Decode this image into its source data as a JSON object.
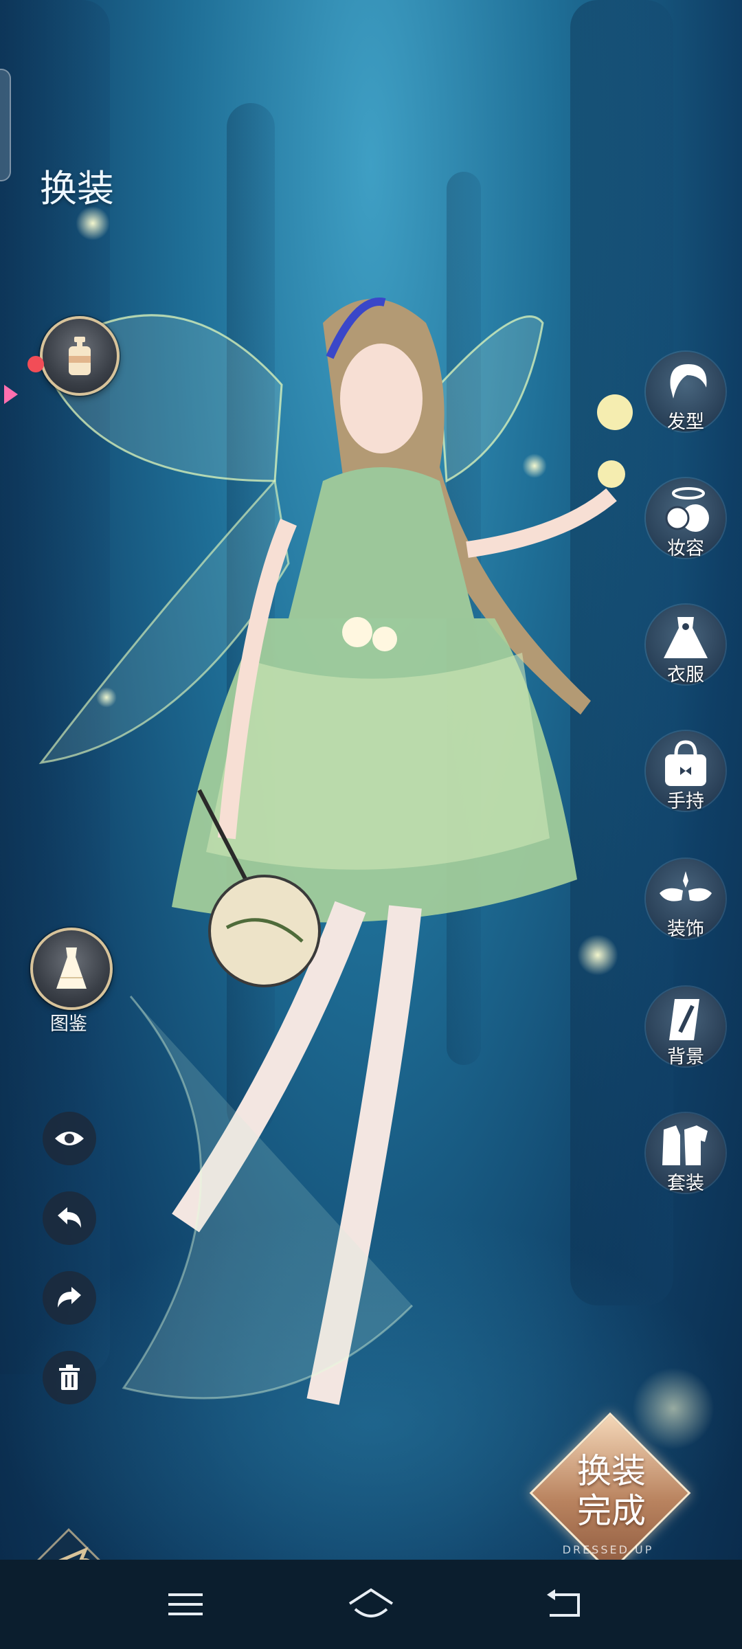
{
  "screen": {
    "title": "换装"
  },
  "left_panel": {
    "cosmetic_button": {
      "icon": "perfume-bottle-icon",
      "has_notification": true
    },
    "catalog": {
      "label": "图鉴",
      "icon": "dress-icon"
    },
    "tools": [
      {
        "name": "preview",
        "icon": "eye-icon"
      },
      {
        "name": "undo",
        "icon": "undo-arrow-icon"
      },
      {
        "name": "redo",
        "icon": "redo-arrow-icon"
      },
      {
        "name": "clear",
        "icon": "trash-icon"
      }
    ]
  },
  "categories": [
    {
      "label": "发型",
      "icon": "hairstyle-icon"
    },
    {
      "label": "妆容",
      "icon": "makeup-icon"
    },
    {
      "label": "衣服",
      "icon": "clothes-icon"
    },
    {
      "label": "手持",
      "icon": "handbag-icon"
    },
    {
      "label": "装饰",
      "icon": "wings-icon"
    },
    {
      "label": "背景",
      "icon": "background-icon"
    },
    {
      "label": "套装",
      "icon": "outfit-set-icon"
    }
  ],
  "done_button": {
    "label_line1": "换装",
    "label_line2": "完成",
    "sublabel": "DRESSED UP"
  },
  "system_nav": {
    "buttons": [
      "menu-icon",
      "home-icon",
      "back-icon"
    ]
  },
  "colors": {
    "accent_gold": "#d8c39a",
    "notification_red": "#f24d57",
    "background_blue": "#1f6f97"
  }
}
